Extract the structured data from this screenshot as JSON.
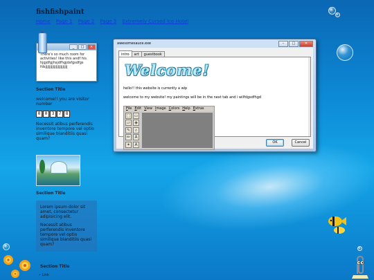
{
  "site": {
    "title": "fishfishpaint",
    "nav": [
      "Home",
      "Page 1",
      "Page 2",
      "Page 3",
      "Extremely Cursed Ice Hotel"
    ]
  },
  "mini_window": {
    "text": "There's so much room for activities! like this andf his hjgjdfgjhsjdfhgjdsfgsdfgs fdsjjjjjjjjjjjjjjjjjjjjjjj"
  },
  "section1": {
    "title": "Section Title",
    "welcome": "welcome!! you are visitor number",
    "counter": [
      "0",
      "0",
      "3",
      "7",
      "8"
    ],
    "para": "Necessit atibus perferendis inventore tempore vel optio similique blanditiis quasi quam?"
  },
  "section2": {
    "title": "Section Title",
    "p1": "Lorem ipsum dolor sit amet, consectetur adipisicing elit.",
    "p2": "Necessit atibus perferendis inventore tempore vel optio similique blanditiis quasi quam?"
  },
  "section3": {
    "title": "Section Title",
    "list_first": "Link"
  },
  "dialog": {
    "title": "awesomesauce.exe",
    "tabs": [
      "intro",
      "art",
      "guestbook"
    ],
    "welcome_art": "Welcome!",
    "line1": "hello!! this website is currently a wip",
    "line2": "welcome to my website! my paintings will be in the next tab and i wilfdgsdfhgd",
    "paint_menu": [
      "File",
      "Edit",
      "View",
      "Image",
      "Colors",
      "Help",
      "Extras"
    ],
    "ok": "OK",
    "cancel": "Cancel"
  }
}
